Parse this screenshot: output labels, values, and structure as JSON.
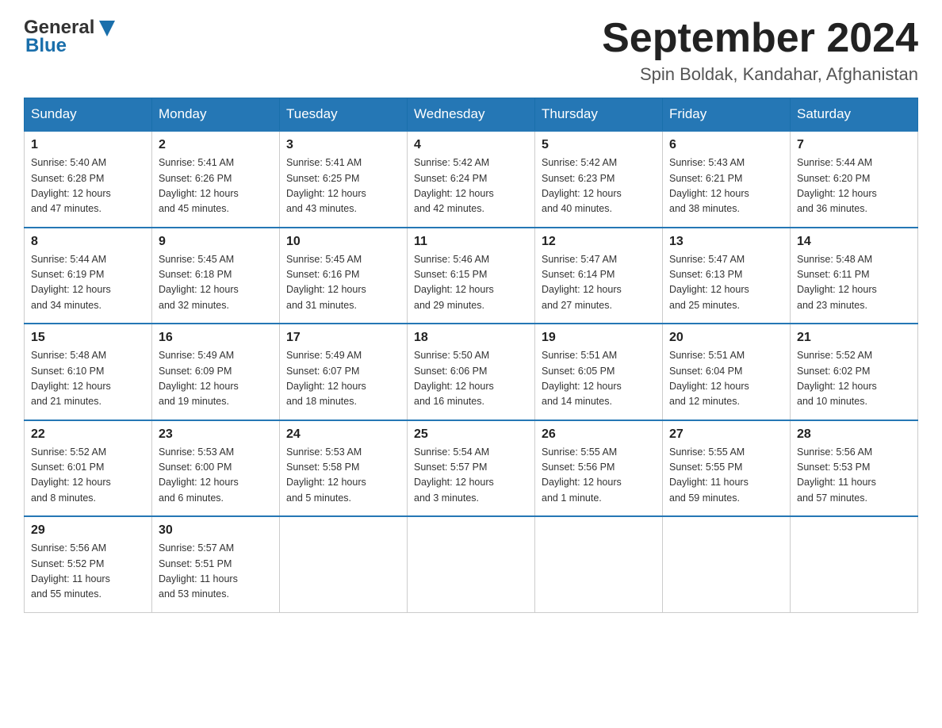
{
  "header": {
    "logo_general": "General",
    "logo_blue": "Blue",
    "month_title": "September 2024",
    "location": "Spin Boldak, Kandahar, Afghanistan"
  },
  "weekdays": [
    "Sunday",
    "Monday",
    "Tuesday",
    "Wednesday",
    "Thursday",
    "Friday",
    "Saturday"
  ],
  "weeks": [
    [
      {
        "day": "1",
        "sunrise": "5:40 AM",
        "sunset": "6:28 PM",
        "daylight": "12 hours and 47 minutes."
      },
      {
        "day": "2",
        "sunrise": "5:41 AM",
        "sunset": "6:26 PM",
        "daylight": "12 hours and 45 minutes."
      },
      {
        "day": "3",
        "sunrise": "5:41 AM",
        "sunset": "6:25 PM",
        "daylight": "12 hours and 43 minutes."
      },
      {
        "day": "4",
        "sunrise": "5:42 AM",
        "sunset": "6:24 PM",
        "daylight": "12 hours and 42 minutes."
      },
      {
        "day": "5",
        "sunrise": "5:42 AM",
        "sunset": "6:23 PM",
        "daylight": "12 hours and 40 minutes."
      },
      {
        "day": "6",
        "sunrise": "5:43 AM",
        "sunset": "6:21 PM",
        "daylight": "12 hours and 38 minutes."
      },
      {
        "day": "7",
        "sunrise": "5:44 AM",
        "sunset": "6:20 PM",
        "daylight": "12 hours and 36 minutes."
      }
    ],
    [
      {
        "day": "8",
        "sunrise": "5:44 AM",
        "sunset": "6:19 PM",
        "daylight": "12 hours and 34 minutes."
      },
      {
        "day": "9",
        "sunrise": "5:45 AM",
        "sunset": "6:18 PM",
        "daylight": "12 hours and 32 minutes."
      },
      {
        "day": "10",
        "sunrise": "5:45 AM",
        "sunset": "6:16 PM",
        "daylight": "12 hours and 31 minutes."
      },
      {
        "day": "11",
        "sunrise": "5:46 AM",
        "sunset": "6:15 PM",
        "daylight": "12 hours and 29 minutes."
      },
      {
        "day": "12",
        "sunrise": "5:47 AM",
        "sunset": "6:14 PM",
        "daylight": "12 hours and 27 minutes."
      },
      {
        "day": "13",
        "sunrise": "5:47 AM",
        "sunset": "6:13 PM",
        "daylight": "12 hours and 25 minutes."
      },
      {
        "day": "14",
        "sunrise": "5:48 AM",
        "sunset": "6:11 PM",
        "daylight": "12 hours and 23 minutes."
      }
    ],
    [
      {
        "day": "15",
        "sunrise": "5:48 AM",
        "sunset": "6:10 PM",
        "daylight": "12 hours and 21 minutes."
      },
      {
        "day": "16",
        "sunrise": "5:49 AM",
        "sunset": "6:09 PM",
        "daylight": "12 hours and 19 minutes."
      },
      {
        "day": "17",
        "sunrise": "5:49 AM",
        "sunset": "6:07 PM",
        "daylight": "12 hours and 18 minutes."
      },
      {
        "day": "18",
        "sunrise": "5:50 AM",
        "sunset": "6:06 PM",
        "daylight": "12 hours and 16 minutes."
      },
      {
        "day": "19",
        "sunrise": "5:51 AM",
        "sunset": "6:05 PM",
        "daylight": "12 hours and 14 minutes."
      },
      {
        "day": "20",
        "sunrise": "5:51 AM",
        "sunset": "6:04 PM",
        "daylight": "12 hours and 12 minutes."
      },
      {
        "day": "21",
        "sunrise": "5:52 AM",
        "sunset": "6:02 PM",
        "daylight": "12 hours and 10 minutes."
      }
    ],
    [
      {
        "day": "22",
        "sunrise": "5:52 AM",
        "sunset": "6:01 PM",
        "daylight": "12 hours and 8 minutes."
      },
      {
        "day": "23",
        "sunrise": "5:53 AM",
        "sunset": "6:00 PM",
        "daylight": "12 hours and 6 minutes."
      },
      {
        "day": "24",
        "sunrise": "5:53 AM",
        "sunset": "5:58 PM",
        "daylight": "12 hours and 5 minutes."
      },
      {
        "day": "25",
        "sunrise": "5:54 AM",
        "sunset": "5:57 PM",
        "daylight": "12 hours and 3 minutes."
      },
      {
        "day": "26",
        "sunrise": "5:55 AM",
        "sunset": "5:56 PM",
        "daylight": "12 hours and 1 minute."
      },
      {
        "day": "27",
        "sunrise": "5:55 AM",
        "sunset": "5:55 PM",
        "daylight": "11 hours and 59 minutes."
      },
      {
        "day": "28",
        "sunrise": "5:56 AM",
        "sunset": "5:53 PM",
        "daylight": "11 hours and 57 minutes."
      }
    ],
    [
      {
        "day": "29",
        "sunrise": "5:56 AM",
        "sunset": "5:52 PM",
        "daylight": "11 hours and 55 minutes."
      },
      {
        "day": "30",
        "sunrise": "5:57 AM",
        "sunset": "5:51 PM",
        "daylight": "11 hours and 53 minutes."
      },
      null,
      null,
      null,
      null,
      null
    ]
  ],
  "labels": {
    "sunrise": "Sunrise:",
    "sunset": "Sunset:",
    "daylight": "Daylight:"
  }
}
